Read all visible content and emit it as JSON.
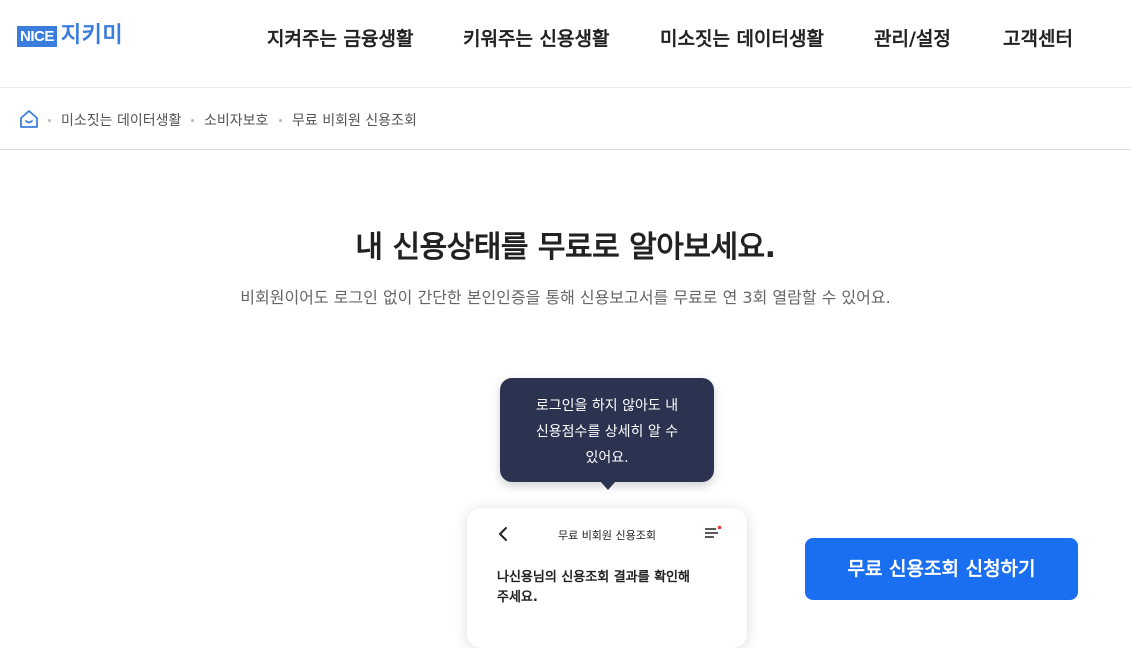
{
  "header": {
    "logo": {
      "nice": "NICE",
      "name": "지키미"
    },
    "nav": [
      {
        "label": "지켜주는 금융생활"
      },
      {
        "label": "키워주는 신용생활"
      },
      {
        "label": "미소짓는 데이터생활"
      },
      {
        "label": "관리/설정"
      },
      {
        "label": "고객센터"
      }
    ]
  },
  "breadcrumb": {
    "home_icon": "home-icon",
    "items": [
      "미소짓는 데이터생활",
      "소비자보호",
      "무료 비회원 신용조회"
    ]
  },
  "main": {
    "title": "내 신용상태를 무료로 알아보세요.",
    "subtitle": "비회원이어도 로그인 없이 간단한 본인인증을 통해 신용보고서를 무료로 연 3회 열람할 수 있어요."
  },
  "tooltip": {
    "lines": [
      "로그인을 하지 않아도 내",
      "신용점수를 상세히 알 수",
      "있어요."
    ]
  },
  "phone": {
    "title": "무료 비회원 신용조회",
    "body_lines": [
      "나신용님의 신용조회 결과를 확인해",
      "주세요."
    ],
    "back_icon": "chevron-left-icon",
    "menu_icon": "menu-icon"
  },
  "cta": {
    "label": "무료 신용조회 신청하기"
  },
  "colors": {
    "brand": "#3b7ddd",
    "cta": "#1a6ff0",
    "tooltip_bg": "#2c3350",
    "menu_dot": "#e53935"
  }
}
